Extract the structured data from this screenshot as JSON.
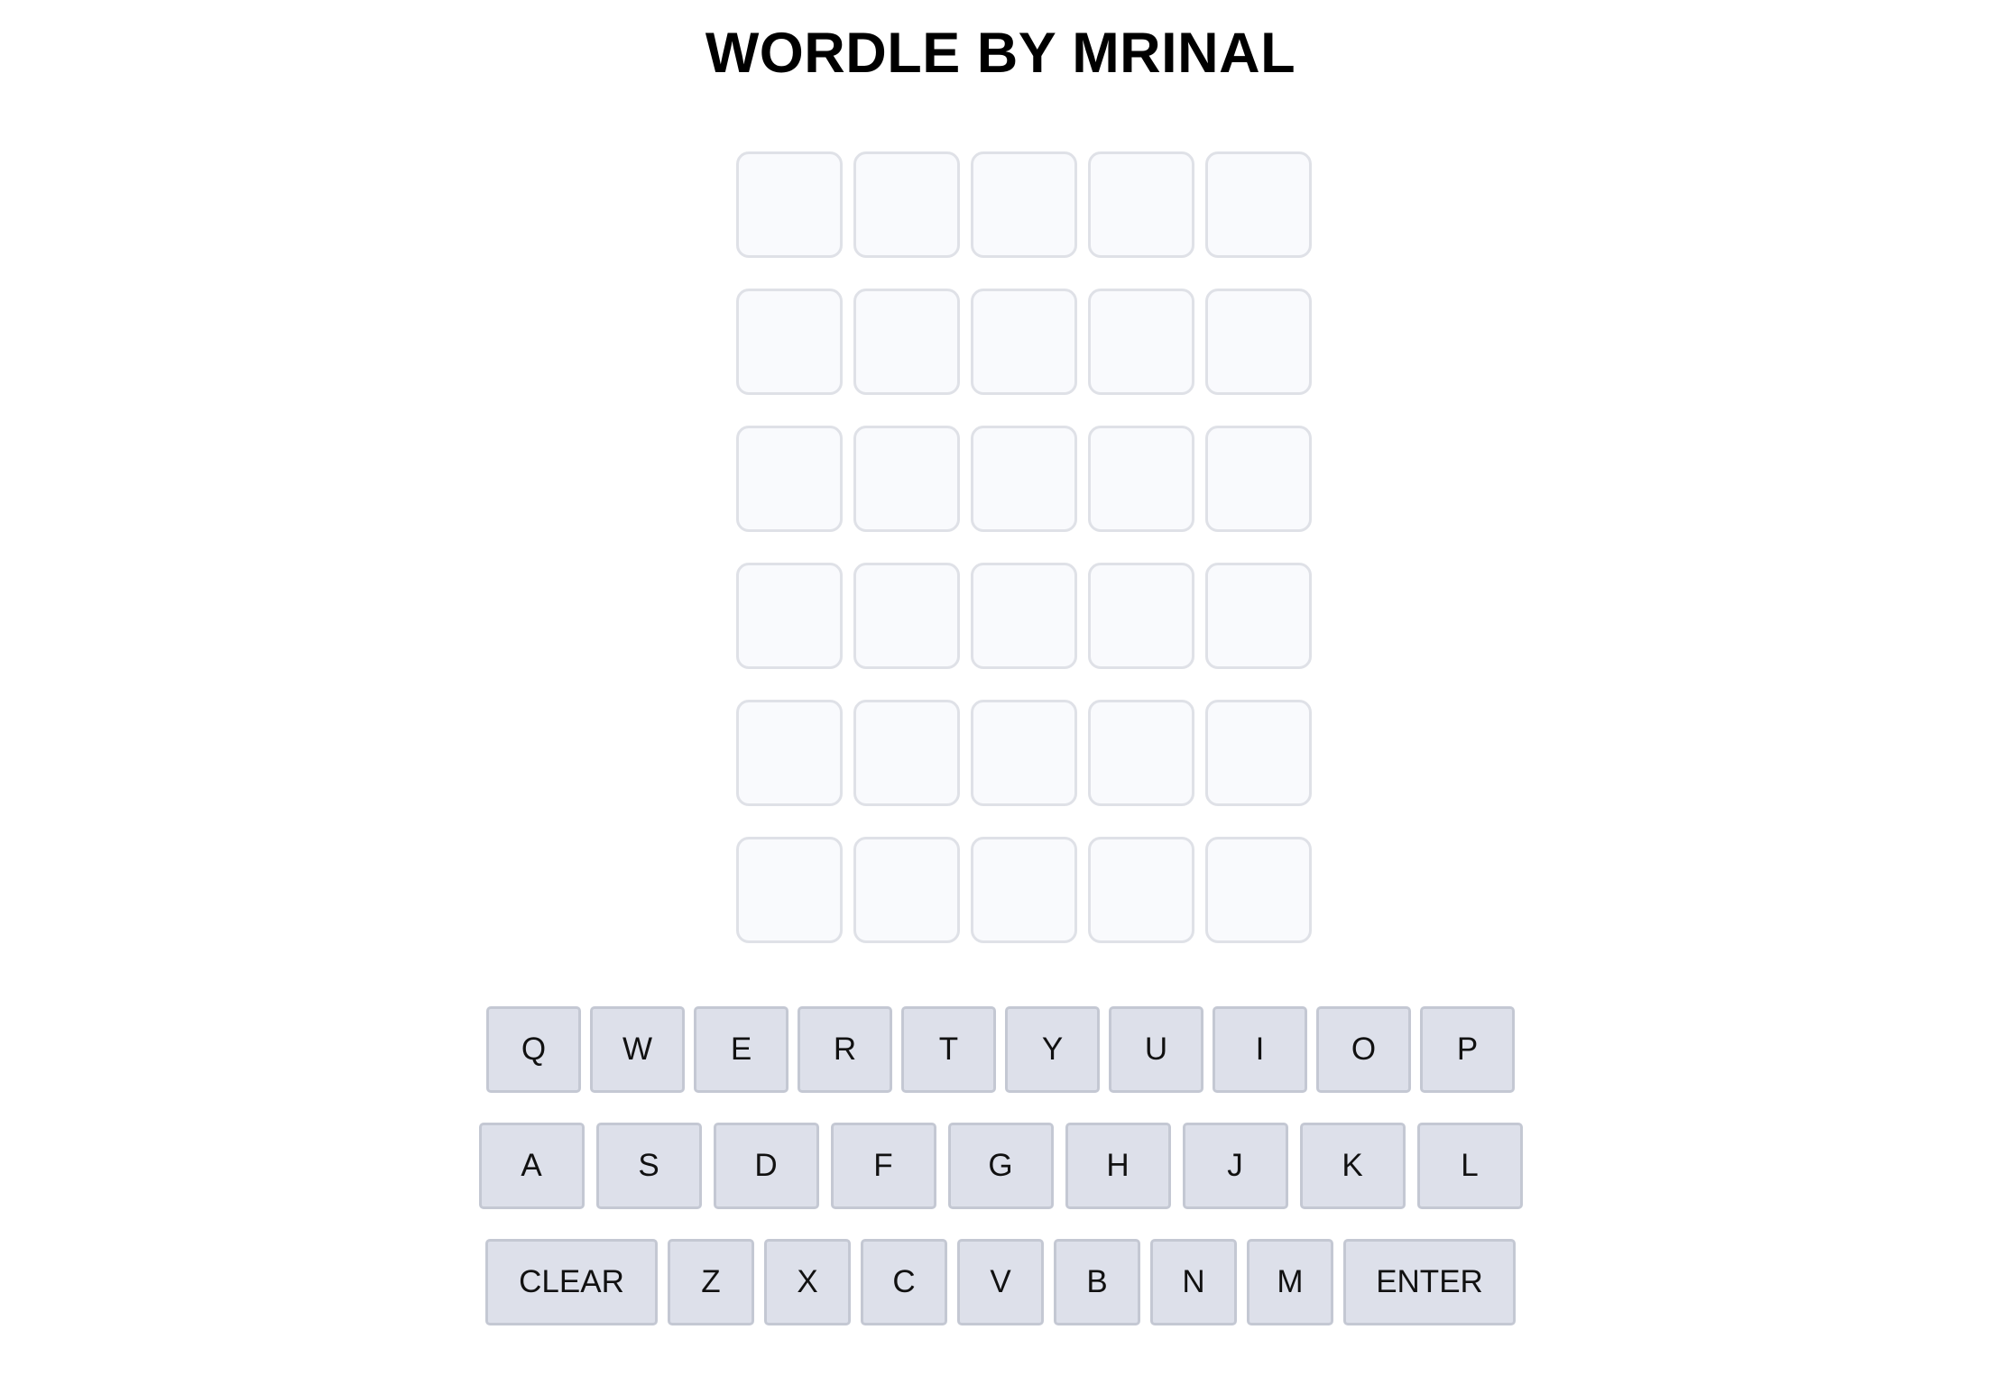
{
  "header": {
    "title": "WORDLE BY MRINAL"
  },
  "board": {
    "rows": [
      [
        "",
        "",
        "",
        "",
        ""
      ],
      [
        "",
        "",
        "",
        "",
        ""
      ],
      [
        "",
        "",
        "",
        "",
        ""
      ],
      [
        "",
        "",
        "",
        "",
        ""
      ],
      [
        "",
        "",
        "",
        "",
        ""
      ],
      [
        "",
        "",
        "",
        "",
        ""
      ]
    ]
  },
  "keyboard": {
    "rows": [
      [
        "Q",
        "W",
        "E",
        "R",
        "T",
        "Y",
        "U",
        "I",
        "O",
        "P"
      ],
      [
        "A",
        "S",
        "D",
        "F",
        "G",
        "H",
        "J",
        "K",
        "L"
      ],
      [
        "CLEAR",
        "Z",
        "X",
        "C",
        "V",
        "B",
        "N",
        "M",
        "ENTER"
      ]
    ]
  },
  "colors": {
    "tile_border": "#dfe1e7",
    "tile_background": "#f9fafd",
    "key_background": "#dde0ea",
    "key_border": "#c4c8d3"
  }
}
